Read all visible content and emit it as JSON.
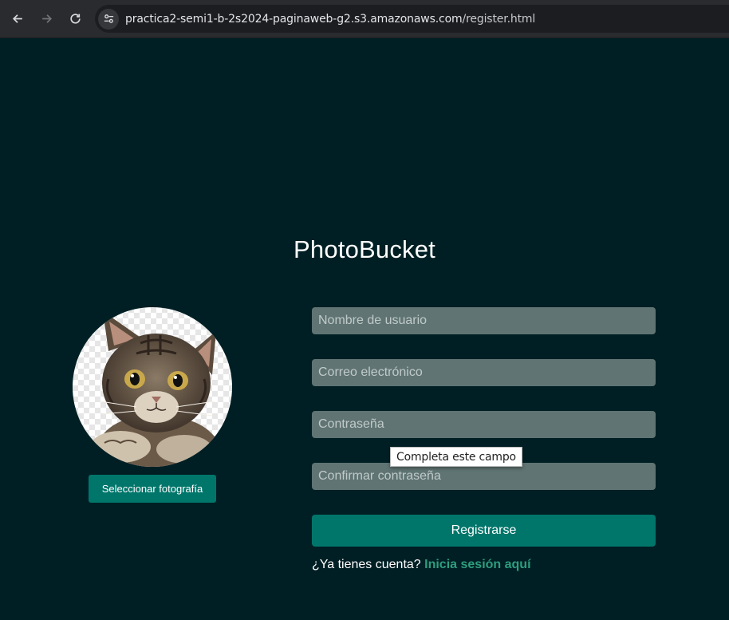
{
  "browser": {
    "url_host": "practica2-semi1-b-2s2024-paginaweb-g2.s3.amazonaws.com",
    "url_path": "/register.html",
    "icons": [
      "back-icon",
      "forward-icon",
      "reload-icon",
      "site-info-icon"
    ]
  },
  "app": {
    "title": "PhotoBucket"
  },
  "avatar": {
    "select_label": "Seleccionar fotografía"
  },
  "form": {
    "username_placeholder": "Nombre de usuario",
    "email_placeholder": "Correo electrónico",
    "password_placeholder": "Contraseña",
    "confirm_placeholder": "Confirmar contraseña",
    "validation_tooltip": "Completa este campo",
    "submit_label": "Registrarse",
    "login_prompt": "¿Ya tienes cuenta?",
    "login_link": "Inicia sesión aquí"
  },
  "colors": {
    "page_background": "#001f24",
    "accent": "#00766b",
    "input_background": "#5f7473",
    "link": "#2e9e7e"
  }
}
